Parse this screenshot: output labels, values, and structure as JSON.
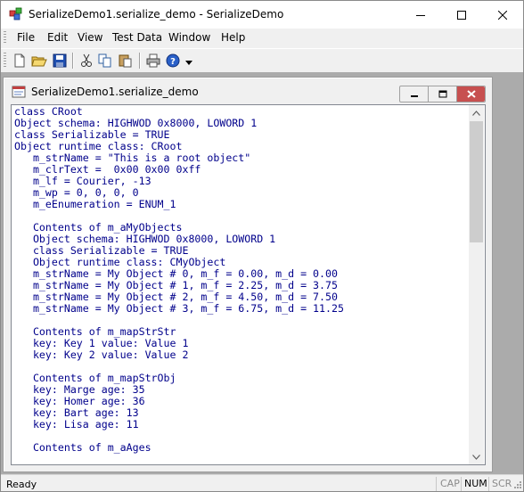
{
  "window": {
    "title": "SerializeDemo1.serialize_demo - SerializeDemo"
  },
  "menubar": {
    "items": [
      "File",
      "Edit",
      "View",
      "Test Data",
      "Window",
      "Help"
    ]
  },
  "toolbar": {
    "buttons": [
      "new-file-icon",
      "open-folder-icon",
      "save-icon",
      "cut-icon",
      "copy-icon",
      "paste-icon",
      "print-icon",
      "help-icon",
      "context-help-arrow-icon"
    ]
  },
  "child_window": {
    "title": "SerializeDemo1.serialize_demo"
  },
  "document": {
    "lines": [
      "class CRoot",
      "Object schema: HIGHWOD 0x8000, LOWORD 1",
      "class Serializable = TRUE",
      "Object runtime class: CRoot",
      "   m_strName = \"This is a root object\"",
      "   m_clrText =  0x00 0x00 0xff",
      "   m_lf = Courier, -13",
      "   m_wp = 0, 0, 0, 0",
      "   m_eEnumeration = ENUM_1",
      "",
      "   Contents of m_aMyObjects",
      "   Object schema: HIGHWOD 0x8000, LOWORD 1",
      "   class Serializable = TRUE",
      "   Object runtime class: CMyObject",
      "   m_strName = My Object # 0, m_f = 0.00, m_d = 0.00",
      "   m_strName = My Object # 1, m_f = 2.25, m_d = 3.75",
      "   m_strName = My Object # 2, m_f = 4.50, m_d = 7.50",
      "   m_strName = My Object # 3, m_f = 6.75, m_d = 11.25",
      "",
      "   Contents of m_mapStrStr",
      "   key: Key 1 value: Value 1",
      "   key: Key 2 value: Value 2",
      "",
      "   Contents of m_mapStrObj",
      "   key: Marge age: 35",
      "   key: Homer age: 36",
      "   key: Bart age: 13",
      "   key: Lisa age: 11",
      "",
      "   Contents of m_aAges"
    ],
    "text_color": "#00008b"
  },
  "statusbar": {
    "text": "Ready",
    "indicators": [
      {
        "label": "CAP",
        "active": false
      },
      {
        "label": "NUM",
        "active": true
      },
      {
        "label": "SCRL",
        "active": false
      }
    ]
  },
  "colors": {
    "mdi_background": "#ababab",
    "close_button": "#c75050"
  }
}
